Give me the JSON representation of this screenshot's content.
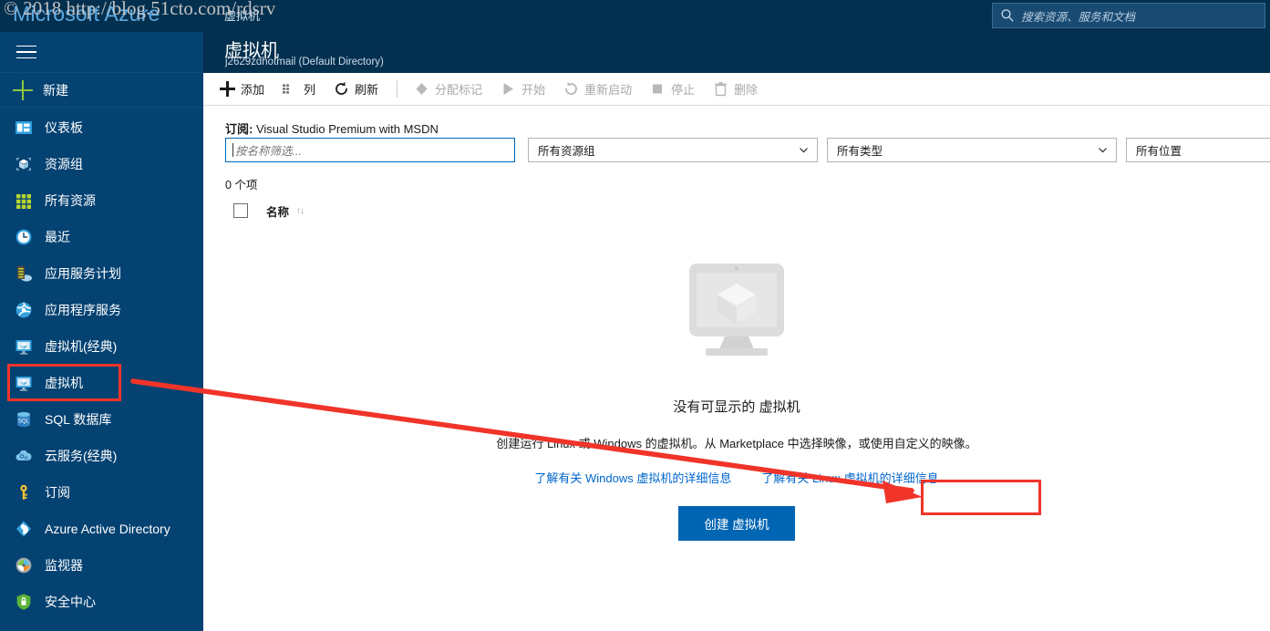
{
  "watermark": "© 2018 http://blog.51cto.com/rdsrv",
  "topbar": {
    "brand": "Microsoft Azure",
    "breadcrumb": "虚拟机",
    "search_placeholder": "搜索资源、服务和文档",
    "search_icon": "search-icon",
    "bg": "#04304f"
  },
  "sidebar": {
    "bg": "#044272",
    "menu_icon": "hamburger-icon",
    "new_label": "新建",
    "new_icon": "plus-icon",
    "items": [
      {
        "label": "仪表板",
        "icon": "dashboard-icon"
      },
      {
        "label": "资源组",
        "icon": "resource-group-icon"
      },
      {
        "label": "所有资源",
        "icon": "all-resources-icon"
      },
      {
        "label": "最近",
        "icon": "recent-clock-icon"
      },
      {
        "label": "应用服务计划",
        "icon": "app-service-plan-icon"
      },
      {
        "label": "应用程序服务",
        "icon": "app-services-icon"
      },
      {
        "label": "虚拟机(经典)",
        "icon": "virtual-machine-classic-icon"
      },
      {
        "label": "虚拟机",
        "icon": "virtual-machine-icon"
      },
      {
        "label": "SQL 数据库",
        "icon": "sql-database-icon"
      },
      {
        "label": "云服务(经典)",
        "icon": "cloud-services-classic-icon"
      },
      {
        "label": "订阅",
        "icon": "subscription-key-icon"
      },
      {
        "label": "Azure Active Directory",
        "icon": "azure-ad-icon"
      },
      {
        "label": "监视器",
        "icon": "monitor-icon"
      },
      {
        "label": "安全中心",
        "icon": "security-center-icon"
      }
    ],
    "selected_index": 7
  },
  "page": {
    "title": "虚拟机",
    "subtitle": "j2629zdhotmail (Default Directory)"
  },
  "commands": [
    {
      "label": "添加",
      "icon": "plus-icon",
      "disabled": false
    },
    {
      "label": "列",
      "icon": "columns-icon",
      "disabled": false
    },
    {
      "label": "刷新",
      "icon": "refresh-icon",
      "disabled": false
    },
    {
      "label": "分配标记",
      "icon": "tag-icon",
      "disabled": true
    },
    {
      "label": "开始",
      "icon": "start-play-icon",
      "disabled": true
    },
    {
      "label": "重新启动",
      "icon": "restart-icon",
      "disabled": true
    },
    {
      "label": "停止",
      "icon": "stop-square-icon",
      "disabled": true
    },
    {
      "label": "删除",
      "icon": "delete-trash-icon",
      "disabled": true
    }
  ],
  "subscription": {
    "label": "订阅:",
    "value": "Visual Studio Premium with MSDN"
  },
  "filters": {
    "name_placeholder": "按名称筛选...",
    "resource_group": "所有资源组",
    "type": "所有类型",
    "location": "所有位置"
  },
  "table": {
    "count_text": "0 个项",
    "column_name": "名称",
    "sort_icon": "sort-arrows-icon",
    "rows": []
  },
  "empty_state": {
    "illustration_icon": "virtual-machine-monitor-illustration",
    "title": "没有可显示的 虚拟机",
    "description": "创建运行 Linux 或 Windows 的虚拟机。从 Marketplace 中选择映像，或使用自定义的映像。",
    "link_windows": "了解有关 Windows 虚拟机的详细信息",
    "link_linux": "了解有关 Linux 虚拟机的详细信息",
    "create_button": "创建 虚拟机"
  },
  "annotations": {
    "highlight_color": "#f0342a",
    "arrow_color": "#f0342a",
    "accent_blue": "#0065b3",
    "link_blue": "#0066cc"
  }
}
